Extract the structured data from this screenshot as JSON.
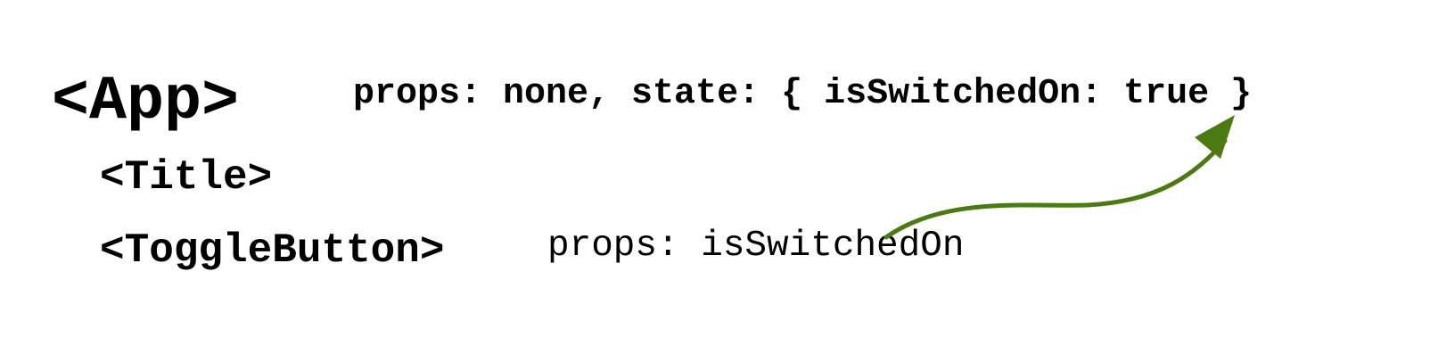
{
  "components": {
    "app": {
      "name": "<App>",
      "description": "props: none, state: { isSwitchedOn: true }"
    },
    "title": {
      "name": "<Title>"
    },
    "toggle_button": {
      "name": "<ToggleButton>",
      "description": "props: isSwitchedOn"
    }
  },
  "colors": {
    "text": "#000000",
    "arrow": "#4a7a10"
  }
}
